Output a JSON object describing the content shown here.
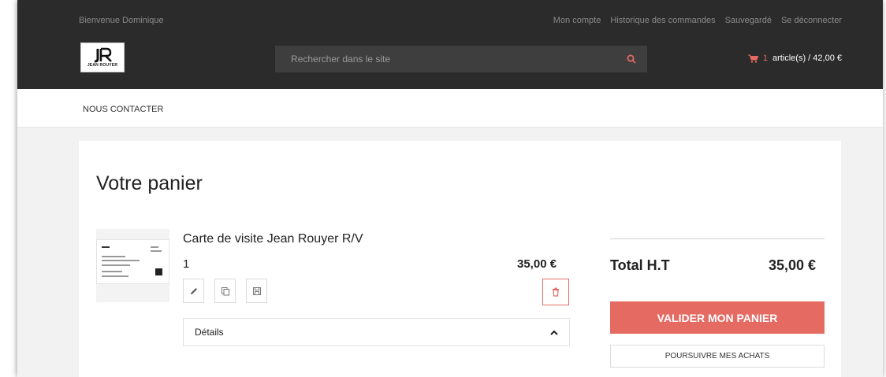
{
  "header": {
    "welcome": "Bienvenue Dominique",
    "links": [
      "Mon compte",
      "Historique des commandes",
      "Sauvegardé",
      "Se déconnecter"
    ],
    "logo_text_line1": "JEAN ROUYER",
    "search_placeholder": "Rechercher dans le site",
    "cart_count": "1",
    "cart_text": "article(s) / 42,00 €"
  },
  "nav": {
    "items": [
      "NOUS CONTACTER"
    ]
  },
  "cart": {
    "title": "Votre panier",
    "item": {
      "name": "Carte de visite Jean Rouyer R/V",
      "quantity": "1",
      "price": "35,00 €",
      "details_label": "Détails"
    },
    "summary": {
      "total_label": "Total H.T",
      "total_value": "35,00 €",
      "validate_label": "VALIDER MON PANIER",
      "continue_label": "POURSUIVRE MES ACHATS"
    }
  },
  "colors": {
    "accent": "#e46a62",
    "header_bg": "#2b2b2b",
    "search_bg": "#3e3e3e"
  },
  "icons": {
    "search": "search-icon",
    "cart": "cart-icon",
    "edit": "pencil-icon",
    "copy": "copy-icon",
    "save": "save-icon",
    "delete": "trash-icon",
    "expand": "chevron-up-icon"
  }
}
